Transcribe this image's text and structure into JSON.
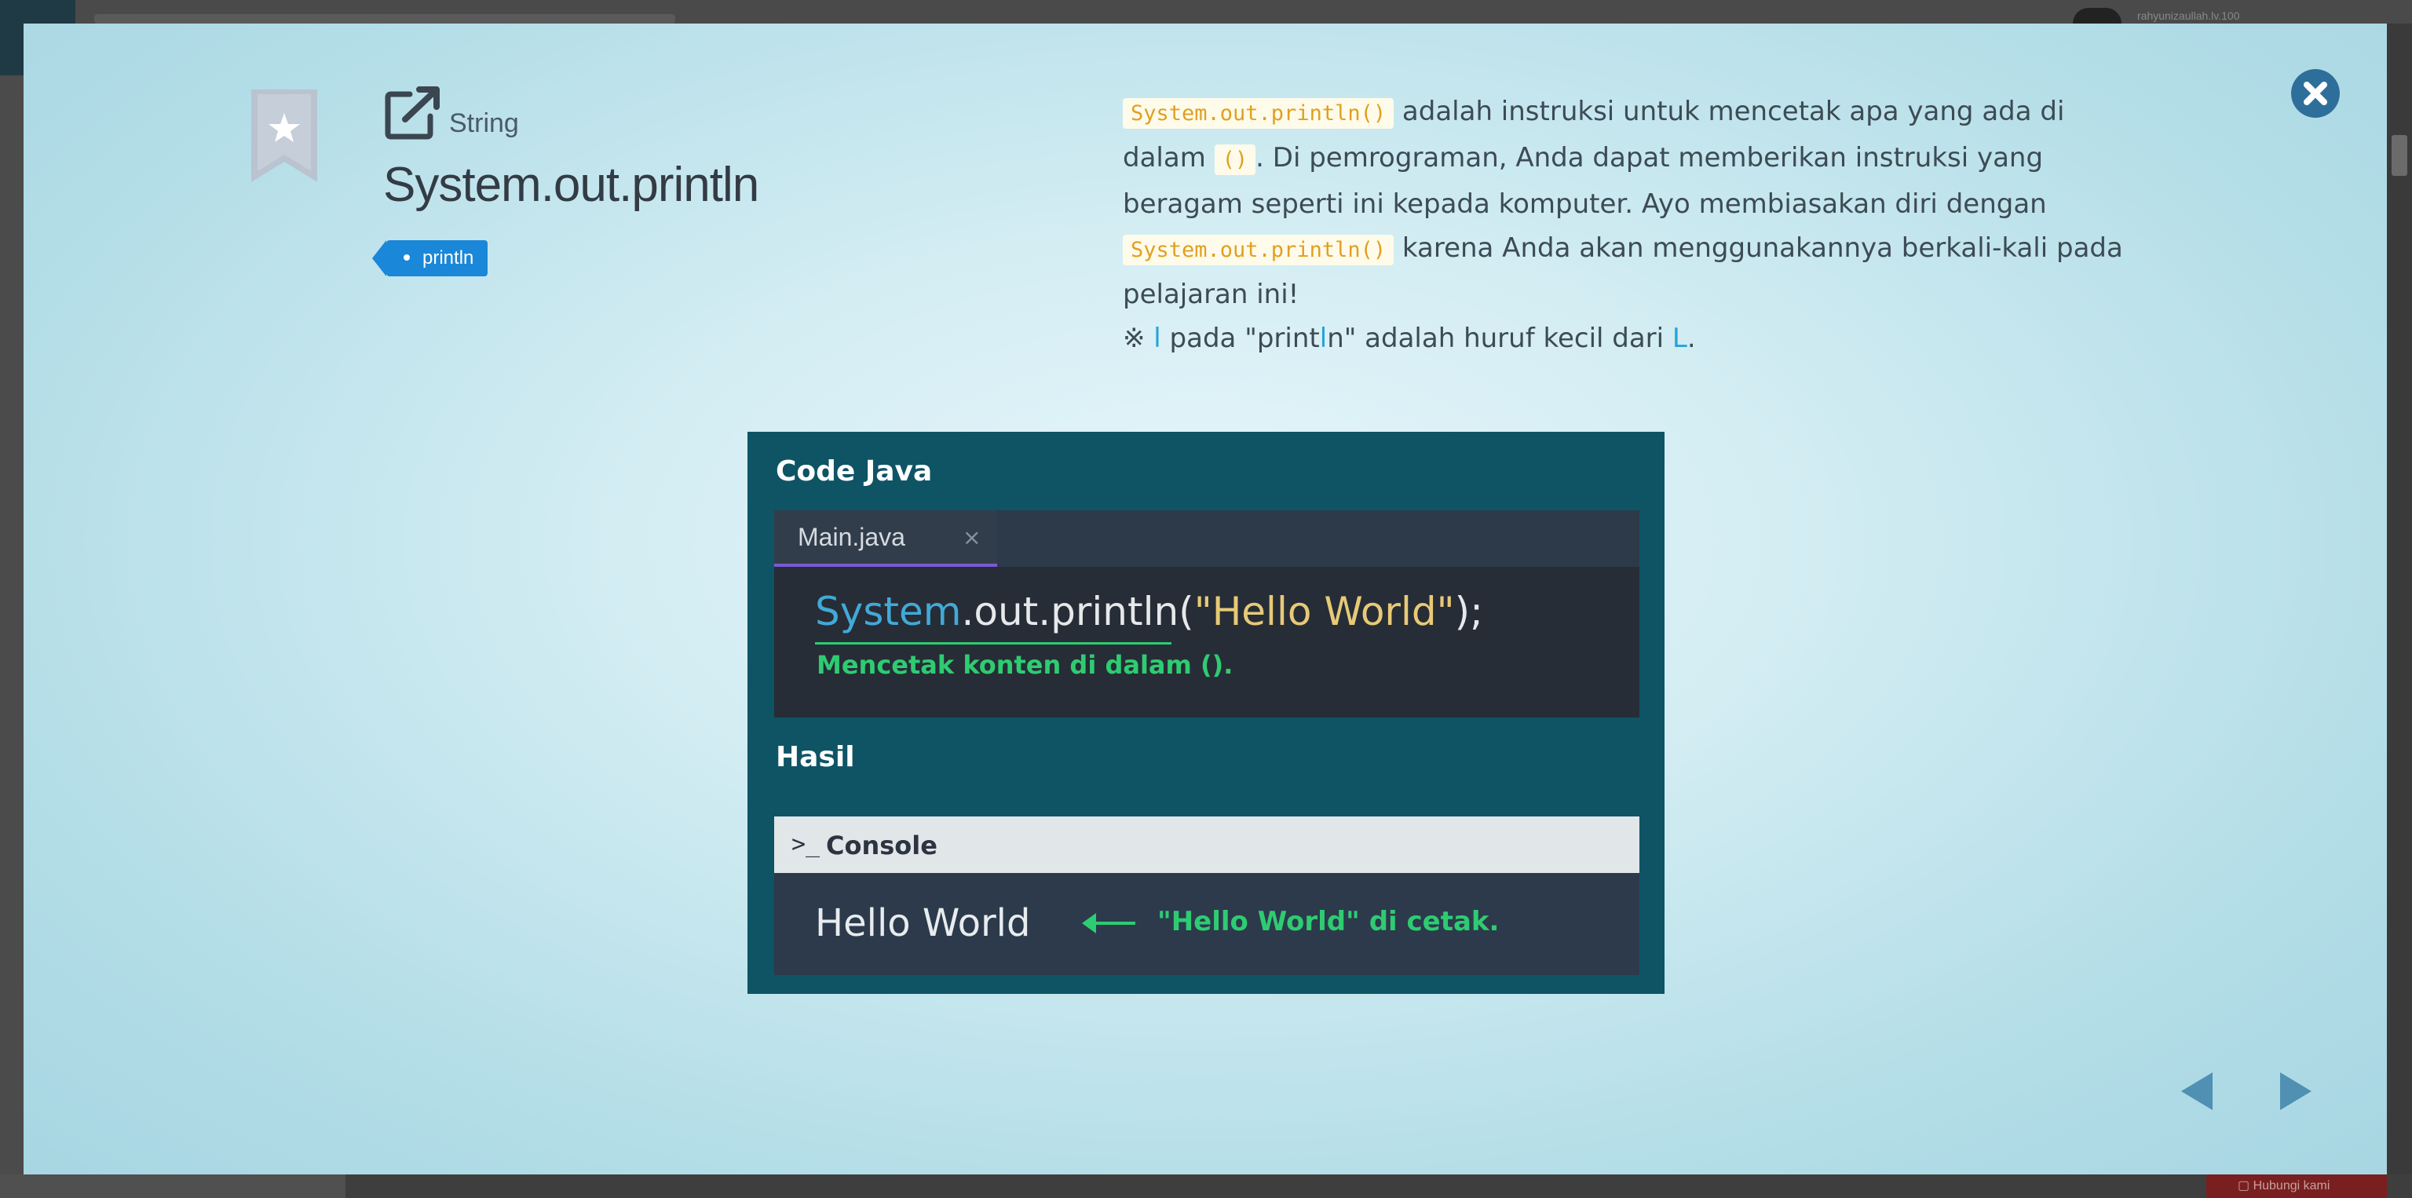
{
  "background": {
    "username": "rahyunizaullah.lv.100"
  },
  "modal": {
    "category": "String",
    "title": "System.out.println",
    "tag": "println",
    "description": {
      "code1": "System.out.println()",
      "text1": " adalah instruksi untuk mencetak apa yang ada di dalam ",
      "code2": "()",
      "text2": ". Di pemrograman, Anda dapat memberikan instruksi yang beragam seperti ini kepada komputer. Ayo membiasakan diri dengan ",
      "code3": "System.out.println()",
      "text3": " karena Anda akan menggunakannya berkali-kali pada pelajaran ini!",
      "note_prefix": "※ ",
      "note_l": "l",
      "note_text1": " pada \"print",
      "note_l2": "l",
      "note_text2": "n\" adalah huruf kecil dari ",
      "note_L": "L",
      "note_end": "."
    },
    "illustration": {
      "code_heading": "Code Java",
      "file_tab": "Main.java",
      "file_tab_close": "×",
      "code_class": "System",
      "code_method": ".out.println(",
      "code_string": "\"Hello World\"",
      "code_end": ");",
      "code_note": "Mencetak konten di dalam ().",
      "result_heading": "Hasil",
      "console_icon": ">_",
      "console_label": "Console",
      "console_output": "Hello World",
      "console_note": "\"Hello World\" di cetak."
    }
  },
  "colors": {
    "accent": "#1a87d8",
    "close_button": "#2d6f9a",
    "nav_arrows": "#4f90b3",
    "code_green": "#2ecc71",
    "code_yellow": "#e0a020"
  },
  "icons": {
    "bookmark": "bookmark-star-icon",
    "open_link": "external-link-icon",
    "close": "close-circle-icon",
    "prev": "triangle-left-icon",
    "next": "triangle-right-icon"
  }
}
